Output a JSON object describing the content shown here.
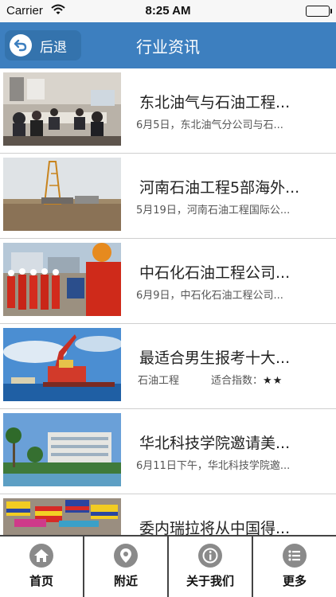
{
  "status_bar": {
    "carrier": "Carrier",
    "time": "8:25 AM",
    "battery_level": 1.0
  },
  "nav": {
    "back_label": "后退",
    "title": "行业资讯"
  },
  "news": [
    {
      "title": "东北油气与石油工程...",
      "summary": "6月5日，东北油气分公司与石..."
    },
    {
      "title": "河南石油工程5部海外...",
      "summary": "5月19日，河南石油工程国际公..."
    },
    {
      "title": "中石化石油工程公司...",
      "summary": "6月9日，中石化石油工程公司..."
    },
    {
      "title": "最适合男生报考十大...",
      "category": "石油工程",
      "rating_label": "适合指数：",
      "rating_stars": "★★"
    },
    {
      "title": "华北科技学院邀请美...",
      "summary": "6月11日下午，华北科技学院邀..."
    },
    {
      "title": "委内瑞拉将从中国得..."
    }
  ],
  "tabs": [
    {
      "label": "首页",
      "icon": "home-icon"
    },
    {
      "label": "附近",
      "icon": "location-pin-icon"
    },
    {
      "label": "关于我们",
      "icon": "info-icon"
    },
    {
      "label": "更多",
      "icon": "list-icon"
    }
  ]
}
